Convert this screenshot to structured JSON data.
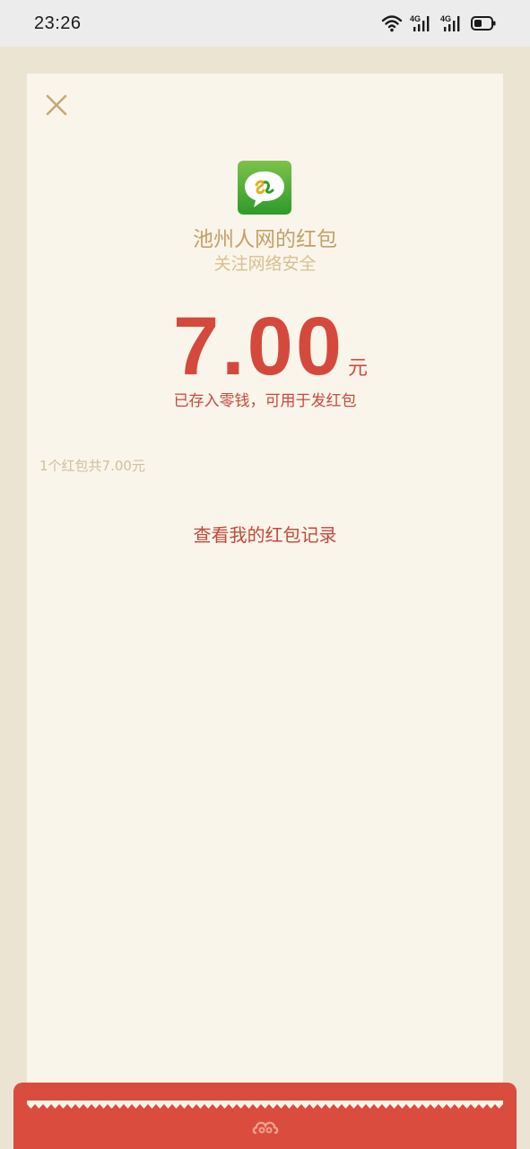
{
  "status_bar": {
    "time": "23:26",
    "icons": [
      "wifi-icon",
      "signal-4g-icon",
      "signal-4g-icon",
      "battery-icon"
    ],
    "network_label": "4G"
  },
  "card": {
    "close_icon": "close-icon",
    "logo_icon": "chizhou-app-logo",
    "sender_name": "池州人网的红包",
    "blessing": "关注网络安全",
    "amount": "7.00",
    "unit": "元",
    "stored_note": "已存入零钱，可用于发红包",
    "summary": "1个红包共7.00元",
    "record_link": "查看我的红包记录"
  },
  "colors": {
    "accent_red": "#d5493d",
    "gold_text": "#c4a06a",
    "card_bg": "#faf5ea",
    "page_bg": "#ece4d2",
    "envelope_red": "#d94c3e"
  }
}
